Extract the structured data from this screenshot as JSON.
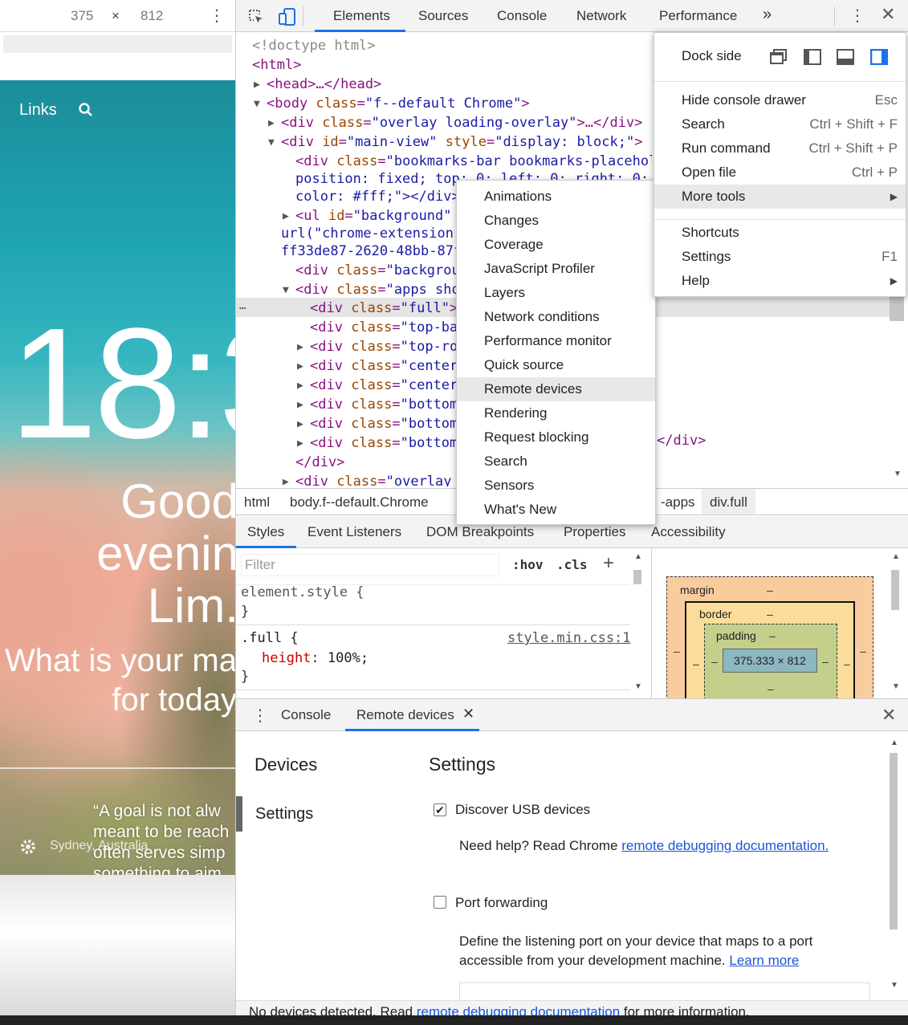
{
  "device_toolbar": {
    "width": "375",
    "times": "×",
    "height": "812"
  },
  "preview": {
    "links": "Links",
    "clock": "18:3",
    "greeting": [
      "Good",
      "evenin",
      "Lim."
    ],
    "question": [
      "What is your ma",
      "for today"
    ],
    "quote": [
      "“A goal is not alw",
      "meant to be reach",
      "often serves simp",
      "something to aim"
    ],
    "location": "Sydney, Australia"
  },
  "tabs": [
    "Elements",
    "Sources",
    "Console",
    "Network",
    "Performance"
  ],
  "code_lines": [
    {
      "i": 0,
      "t": "<!doctype html>",
      "k": "gr"
    },
    {
      "i": 0,
      "t": "<html>",
      "k": "tag"
    },
    {
      "i": 1,
      "arrow": "▶",
      "t": "<head>…</head>",
      "k": "tag"
    },
    {
      "i": 1,
      "arrow": "▼",
      "pre": "<body ",
      "an": "class",
      "av": "\"f--default Chrome\"",
      "post": ">"
    },
    {
      "i": 2,
      "arrow": "▶",
      "pre": "<div ",
      "an": "class",
      "av": "\"overlay loading-overlay\"",
      "post": ">…</div>"
    },
    {
      "i": 2,
      "arrow": "▼",
      "pre": "<div ",
      "an": "id",
      "av": "\"main-view\"",
      "an2": "style",
      "av2": "\"display: block;\"",
      "post": ">"
    },
    {
      "i": 3,
      "pre": "<div ",
      "an": "class",
      "av": "\"bookmarks-bar bookmarks-placehold"
    },
    {
      "i": 3,
      "raw": "position: fixed; top: 0; left: 0; right: 0; d",
      "k": "av"
    },
    {
      "i": 3,
      "raw": "color: #fff;\"></div>",
      "k": "av"
    },
    {
      "i": 3,
      "arrow": "▶",
      "pre": "<ul ",
      "an": "id",
      "av": "\"background\""
    },
    {
      "i": 2,
      "raw": "url(\"chrome-extension:",
      "k": "av"
    },
    {
      "i": 2,
      "raw": "ff33de87-2620-48bb-87f",
      "k": "av"
    },
    {
      "i": 3,
      "pre": "<div ",
      "an": "class",
      "av": "\"backgrou"
    },
    {
      "i": 3,
      "arrow": "▼",
      "pre": "<div ",
      "an": "class",
      "av": "\"apps sho"
    },
    {
      "i": 4,
      "pre": "<div ",
      "an": "class",
      "av": "\"full\"",
      "post": ">"
    },
    {
      "i": 4,
      "pre": "<div ",
      "an": "class",
      "av": "\"top-bar"
    },
    {
      "i": 4,
      "arrow": "▶",
      "pre": "<div ",
      "an": "class",
      "av": "\"top-row"
    },
    {
      "i": 4,
      "arrow": "▶",
      "pre": "<div ",
      "an": "class",
      "av": "\"center"
    },
    {
      "i": 4,
      "arrow": "▶",
      "pre": "<div ",
      "an": "class",
      "av": "\"center"
    },
    {
      "i": 4,
      "arrow": "▶",
      "pre": "<div ",
      "an": "class",
      "av": "\"bottom"
    },
    {
      "i": 4,
      "arrow": "▶",
      "pre": "<div ",
      "an": "class",
      "av": "\"bottom-"
    },
    {
      "i": 4,
      "arrow": "▶",
      "pre": "<div ",
      "an": "class",
      "av": "\"bottom-"
    },
    {
      "i": 3,
      "raw": "</div>",
      "k": "tag"
    },
    {
      "i": 3,
      "arrow": "▶",
      "pre": "<div ",
      "an": "class",
      "av": "\"overlay "
    }
  ],
  "code_tail": "</div>",
  "breadcrumbs": [
    "html",
    "body.f--default.Chrome",
    "-apps",
    "div.full"
  ],
  "styles_tabs": [
    "Styles",
    "Event Listeners",
    "DOM Breakpoints",
    "Properties",
    "Accessibility"
  ],
  "styles": {
    "filter_placeholder": "Filter",
    "hov": ":hov",
    "cls": ".cls",
    "element_style": "element.style {",
    "close": "}",
    "rule_selector": ".full {",
    "rule_source": "style.min.css:1",
    "rule_prop": "height",
    "rule_val": "100%;"
  },
  "box_model": {
    "margin": "margin",
    "border": "border",
    "padding": "padding",
    "dash": "–",
    "content": "375.333 × 812"
  },
  "drawer_tabs": {
    "console": "Console",
    "remote": "Remote devices"
  },
  "remote": {
    "nav": [
      "Devices",
      "Settings"
    ],
    "heading": "Settings",
    "usb_label": "Discover USB devices",
    "usb_checked": true,
    "help_prefix": "Need help? Read Chrome ",
    "help_link": "remote debugging documentation.",
    "port_label": "Port forwarding",
    "port_checked": false,
    "port_desc1": "Define the listening port on your device that maps to a port",
    "port_desc2": "accessible from your development machine. ",
    "port_link": "Learn more",
    "status_prefix": "No devices detected. Read ",
    "status_link": "remote debugging documentation",
    "status_suffix": " for more information."
  },
  "main_menu": {
    "dock_side": "Dock side",
    "items": [
      {
        "label": "Hide console drawer",
        "shortcut": "Esc"
      },
      {
        "label": "Search",
        "shortcut": "Ctrl + Shift + F"
      },
      {
        "label": "Run command",
        "shortcut": "Ctrl + Shift + P"
      },
      {
        "label": "Open file",
        "shortcut": "Ctrl + P"
      },
      {
        "label": "More tools",
        "shortcut": "▶"
      }
    ],
    "items2": [
      {
        "label": "Shortcuts",
        "shortcut": ""
      },
      {
        "label": "Settings",
        "shortcut": "F1"
      },
      {
        "label": "Help",
        "shortcut": "▶"
      }
    ]
  },
  "more_tools": [
    "Animations",
    "Changes",
    "Coverage",
    "JavaScript Profiler",
    "Layers",
    "Network conditions",
    "Performance monitor",
    "Quick source",
    "Remote devices",
    "Rendering",
    "Request blocking",
    "Search",
    "Sensors",
    "What's New"
  ],
  "colors": {
    "accent": "#1a73e8",
    "tag": "#881280",
    "attr_name": "#994500",
    "attr_value": "#1a1aa6",
    "link": "#1a55d8"
  }
}
